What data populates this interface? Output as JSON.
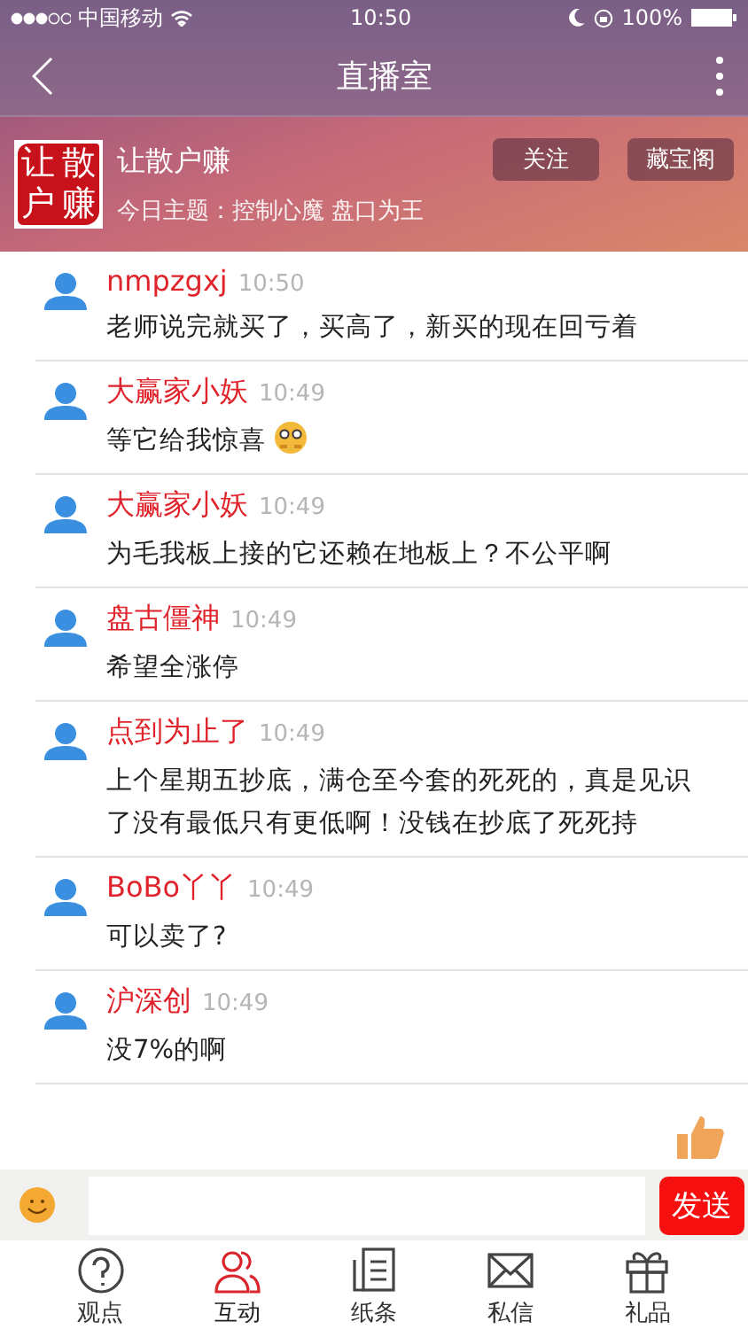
{
  "status_bar": {
    "carrier": "中国移动",
    "time": "10:50",
    "battery": "100%"
  },
  "nav": {
    "title": "直播室"
  },
  "room": {
    "logo_text": [
      "让",
      "散",
      "户",
      "赚"
    ],
    "name": "让散户赚",
    "topic": "今日主题：控制心魔 盘口为王",
    "buttons": [
      "关注",
      "藏宝阁"
    ]
  },
  "messages": [
    {
      "user": "nmpzgxj",
      "time": "10:50",
      "text": "老师说完就买了，买高了，新买的现在回亏着",
      "emoji": false
    },
    {
      "user": "大赢家小妖",
      "time": "10:49",
      "text": "等它给我惊喜",
      "emoji": true
    },
    {
      "user": "大赢家小妖",
      "time": "10:49",
      "text": "为毛我板上接的它还赖在地板上？不公平啊",
      "emoji": false
    },
    {
      "user": "盘古僵神",
      "time": "10:49",
      "text": "希望全涨停",
      "emoji": false
    },
    {
      "user": "点到为止了",
      "time": "10:49",
      "text": "上个星期五抄底，满仓至今套的死死的，真是见识了没有最低只有更低啊！没钱在抄底了死死持",
      "emoji": false
    },
    {
      "user": "BoBo丫丫",
      "time": "10:49",
      "text": "可以卖了?",
      "emoji": false
    },
    {
      "user": "沪深创",
      "time": "10:49",
      "text": "没7%的啊",
      "emoji": false
    }
  ],
  "composer": {
    "send": "发送"
  },
  "tabs": [
    {
      "label": "观点",
      "kind": "question",
      "selected": false
    },
    {
      "label": "互动",
      "kind": "people",
      "selected": true
    },
    {
      "label": "纸条",
      "kind": "note",
      "selected": false
    },
    {
      "label": "私信",
      "kind": "mail",
      "selected": false
    },
    {
      "label": "礼品",
      "kind": "gift",
      "selected": false
    }
  ]
}
